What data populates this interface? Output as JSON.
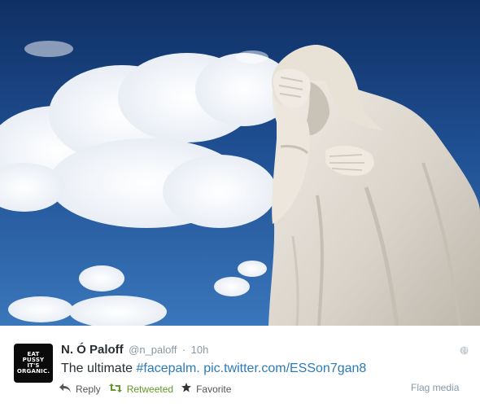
{
  "tweet": {
    "fullname": "N. Ó Paloff",
    "screenname": "@n_paloff",
    "separator": "·",
    "time": "10h",
    "text_prefix": "The ultimate ",
    "hashtag": "#facepalm.",
    "pic_link": "pic.twitter.com/ESSon7gan8"
  },
  "avatar": {
    "lines": [
      "EAT",
      "PUSSY",
      "IT'S",
      "ORGANIC."
    ]
  },
  "actions": {
    "reply": "Reply",
    "retweeted": "Retweeted",
    "favorite": "Favorite",
    "flag_media": "Flag media"
  },
  "icons": {
    "reply": "reply-arrow-icon",
    "retweet": "retweet-icon",
    "favorite": "star-icon",
    "globe": "globe-icon"
  },
  "colors": {
    "retweeted": "#609928",
    "link": "#2b7bb9",
    "sky": "#1f4d8f"
  }
}
